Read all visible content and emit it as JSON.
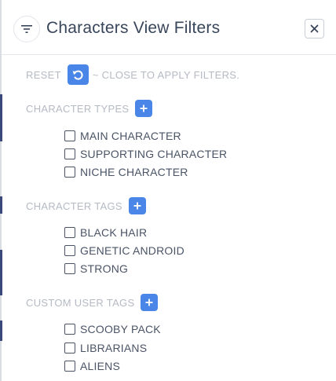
{
  "header": {
    "title": "Characters View Filters",
    "filter_icon": "filter-icon",
    "close_icon": "close-icon"
  },
  "reset": {
    "label": "RESET",
    "icon": "undo-icon",
    "hint": "~ CLOSE TO APPLY FILTERS."
  },
  "sections": [
    {
      "title": "CHARACTER TYPES",
      "add_icon": "plus-icon",
      "options": [
        {
          "label": "MAIN CHARACTER",
          "checked": false
        },
        {
          "label": "SUPPORTING CHARACTER",
          "checked": false
        },
        {
          "label": "NICHE CHARACTER",
          "checked": false
        }
      ]
    },
    {
      "title": "CHARACTER TAGS",
      "add_icon": "plus-icon",
      "options": [
        {
          "label": "BLACK HAIR",
          "checked": false
        },
        {
          "label": "GENETIC ANDROID",
          "checked": false
        },
        {
          "label": "STRONG",
          "checked": false
        }
      ]
    },
    {
      "title": "CUSTOM USER TAGS",
      "add_icon": "plus-icon",
      "options": [
        {
          "label": "SCOOBY PACK",
          "checked": false
        },
        {
          "label": "LIBRARIANS",
          "checked": false
        },
        {
          "label": "ALIENS",
          "checked": false
        }
      ]
    }
  ],
  "colors": {
    "accent": "#4a86e8",
    "title_text": "#39465a",
    "muted_text": "#b5bac4",
    "option_text": "#4a5466"
  }
}
